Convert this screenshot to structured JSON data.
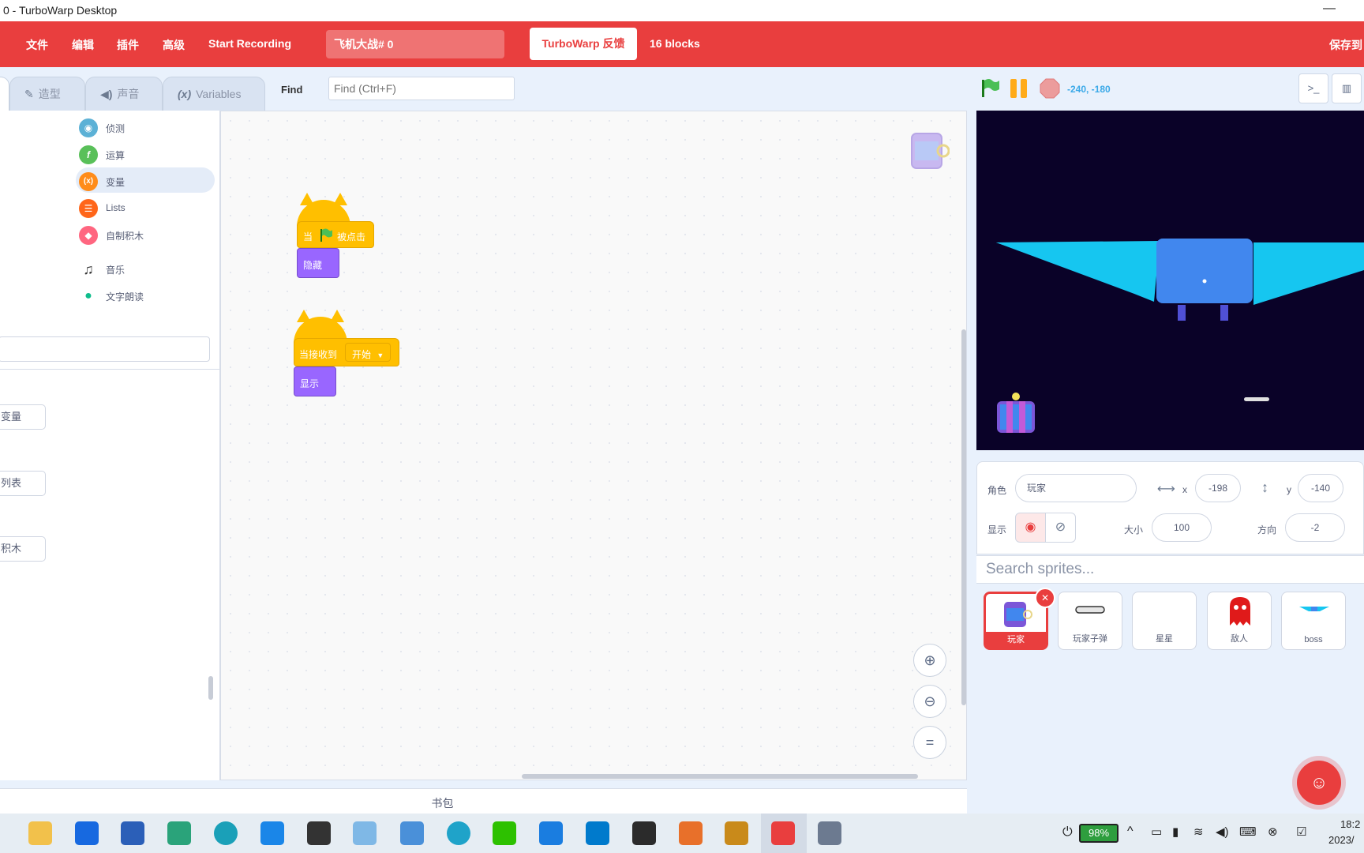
{
  "window": {
    "title": "0 - TurboWarp Desktop",
    "minimize_glyph": "—"
  },
  "menubar": {
    "items": [
      "文件",
      "编辑",
      "插件",
      "高级",
      "Start Recording"
    ],
    "project_title": "飞机大战# 0",
    "feedback_button": "TurboWarp 反馈",
    "block_count": "16 blocks",
    "save_label": "保存到"
  },
  "tabs": {
    "costumes": "造型",
    "sounds": "声音",
    "variables_icon": "(x)",
    "variables": "Variables",
    "find_label": "Find",
    "find_placeholder": "Find (Ctrl+F)"
  },
  "palette": {
    "categories": [
      {
        "label": "侦测",
        "color": "#5cb1d6",
        "icon": "sensing-icon"
      },
      {
        "label": "运算",
        "color": "#59c059",
        "icon": "operators-icon"
      },
      {
        "label": "变量",
        "color": "#ff8c1a",
        "icon": "variables-icon"
      },
      {
        "label": "Lists",
        "color": "#ff661a",
        "icon": "lists-icon"
      },
      {
        "label": "自制积木",
        "color": "#ff6680",
        "icon": "my-blocks-icon"
      },
      {
        "label": "音乐",
        "color": "#0fbd8c",
        "icon": "music-icon"
      },
      {
        "label": "文字朗读",
        "color": "#0fbd8c",
        "icon": "text-to-speech-icon"
      }
    ],
    "buttons": [
      "变量",
      "列表",
      "积木"
    ]
  },
  "scripts": {
    "script1": {
      "hat_when": "当",
      "hat_clicked": "被点击",
      "block": "隐藏"
    },
    "script2": {
      "hat_label": "当接收到",
      "dropdown": "开始",
      "block": "显示"
    }
  },
  "backpack": {
    "label": "书包"
  },
  "stage_header": {
    "coords": "-240, -180"
  },
  "sprite_info": {
    "sprite_label": "角色",
    "sprite_name": "玩家",
    "x_label": "x",
    "x": "-198",
    "y_label": "y",
    "y": "-140",
    "show_label": "显示",
    "size_label": "大小",
    "size": "100",
    "direction_label": "方向",
    "direction": "-2"
  },
  "sprite_search_placeholder": "Search sprites...",
  "sprites": [
    {
      "name": "玩家",
      "selected": true
    },
    {
      "name": "玩家子弹",
      "selected": false
    },
    {
      "name": "星星",
      "selected": false
    },
    {
      "name": "敌人",
      "selected": false
    },
    {
      "name": "boss",
      "selected": false
    }
  ],
  "colors": {
    "accent": "#e93e3e",
    "workspace_bg": "#e9f1fc",
    "stage_bg": "#0a0228"
  },
  "taskbar": {
    "battery": "98%",
    "time": "18:2",
    "date": "2023/"
  }
}
